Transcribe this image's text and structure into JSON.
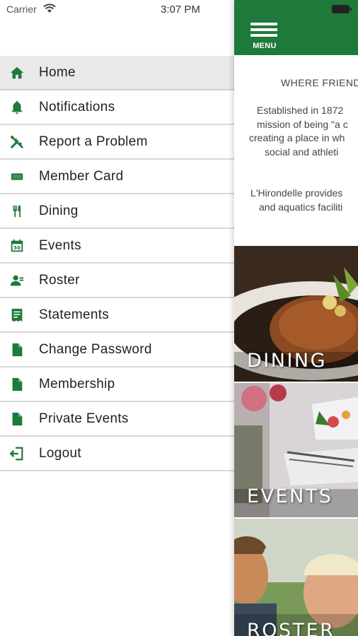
{
  "status_bar": {
    "carrier": "Carrier",
    "time": "3:07 PM"
  },
  "drawer": {
    "accent_color": "#1e7a3a",
    "items": [
      {
        "label": "Home",
        "icon": "home-icon",
        "active": true
      },
      {
        "label": "Notifications",
        "icon": "bell-icon",
        "active": false
      },
      {
        "label": "Report a Problem",
        "icon": "tools-icon",
        "active": false
      },
      {
        "label": "Member Card",
        "icon": "card-icon",
        "active": false
      },
      {
        "label": "Dining",
        "icon": "dining-icon",
        "active": false
      },
      {
        "label": "Events",
        "icon": "calendar-icon",
        "active": false
      },
      {
        "label": "Roster",
        "icon": "person-icon",
        "active": false
      },
      {
        "label": "Statements",
        "icon": "statement-icon",
        "active": false
      },
      {
        "label": "Change Password",
        "icon": "document-icon",
        "active": false
      },
      {
        "label": "Membership",
        "icon": "document-icon",
        "active": false
      },
      {
        "label": "Private Events",
        "icon": "document-icon",
        "active": false
      },
      {
        "label": "Logout",
        "icon": "logout-icon",
        "active": false
      }
    ],
    "calendar_day": "30"
  },
  "main": {
    "header_color": "#1e7a3a",
    "menu_label": "MENU",
    "tagline": "WHERE FRIEND",
    "paragraph1": [
      "Established in 1872",
      "mission of being \"a c",
      "creating a place in wh",
      "social and athleti"
    ],
    "paragraph2": [
      "L'Hirondelle provides",
      "and aquatics faciliti"
    ],
    "tiles": [
      {
        "label": "DINING"
      },
      {
        "label": "EVENTS"
      },
      {
        "label": "ROSTER"
      }
    ]
  }
}
